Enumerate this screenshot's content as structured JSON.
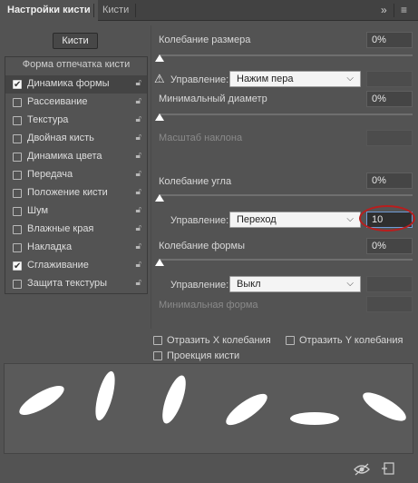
{
  "tabs": [
    {
      "label": "Настройки кисти",
      "active": true
    },
    {
      "label": "Кисти",
      "active": false
    }
  ],
  "header_icons": {
    "collapse": "»",
    "menu": "≡"
  },
  "presets_button": "Кисти",
  "list": {
    "heading": "Форма отпечатка кисти",
    "items": [
      {
        "label": "Динамика формы",
        "checked": true,
        "selected": true,
        "lock": true
      },
      {
        "label": "Рассеивание",
        "checked": false,
        "lock": true
      },
      {
        "label": "Текстура",
        "checked": false,
        "lock": true
      },
      {
        "label": "Двойная кисть",
        "checked": false,
        "lock": true
      },
      {
        "label": "Динамика цвета",
        "checked": false,
        "lock": true
      },
      {
        "label": "Передача",
        "checked": false,
        "lock": true
      },
      {
        "label": "Положение кисти",
        "checked": false,
        "lock": true
      },
      {
        "label": "Шум",
        "checked": false,
        "lock": true
      },
      {
        "label": "Влажные края",
        "checked": false,
        "lock": true
      },
      {
        "label": "Накладка",
        "checked": false,
        "lock": true
      },
      {
        "label": "Сглаживание",
        "checked": true,
        "lock": true
      },
      {
        "label": "Защита текстуры",
        "checked": false,
        "lock": true
      }
    ]
  },
  "size_jitter": {
    "label": "Колебание размера",
    "value": "0%"
  },
  "size_control": {
    "label": "Управление:",
    "selected": "Нажим пера",
    "value": ""
  },
  "min_diameter": {
    "label": "Минимальный диаметр",
    "value": "0%"
  },
  "tilt_scale": {
    "label": "Масштаб наклона",
    "value": ""
  },
  "angle_jitter": {
    "label": "Колебание угла",
    "value": "0%"
  },
  "angle_control": {
    "label": "Управление:",
    "selected": "Переход",
    "value": "10"
  },
  "roundness_jitter": {
    "label": "Колебание формы",
    "value": "0%"
  },
  "roundness_control": {
    "label": "Управление:",
    "selected": "Выкл",
    "value": ""
  },
  "min_roundness": {
    "label": "Минимальная форма",
    "value": ""
  },
  "flip_x": {
    "label": "Отразить X колебания",
    "checked": false
  },
  "flip_y": {
    "label": "Отразить Y колебания",
    "checked": false
  },
  "brush_projection": {
    "label": "Проекция кисти",
    "checked": false
  },
  "colors": {
    "panel": "#535353",
    "tabbar": "#424242",
    "highlight": "#b81e1e",
    "focus": "#6f9bd6"
  },
  "footer_icons": [
    "eye-toggle-icon",
    "new-preset-icon"
  ]
}
